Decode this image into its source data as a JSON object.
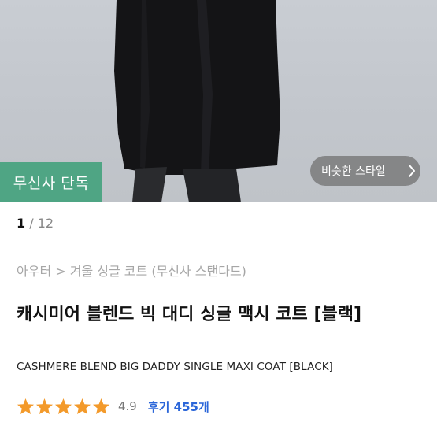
{
  "hero": {
    "badge": "무신사 단독",
    "similar_style_label": "비슷한 스타일"
  },
  "pager": {
    "current": "1",
    "separator": " / ",
    "total": "12"
  },
  "breadcrumb": "아우터 > 겨울 싱글 코트 (무신사 스탠다드)",
  "product": {
    "title": "캐시미어 블렌드 빅 대디 싱글 맥시 코트 [블랙]",
    "title_en": "CASHMERE BLEND BIG DADDY SINGLE MAXI COAT [BLACK]"
  },
  "rating": {
    "stars": 5,
    "score": "4.9",
    "reviews_label": "후기 455개",
    "star_color": "#f39a2b"
  },
  "colors": {
    "badge_bg": "#4fa584",
    "review_link": "#2b66d9"
  },
  "icons": {
    "similar_chevron": "chevron-right-icon",
    "star": "star-icon"
  }
}
